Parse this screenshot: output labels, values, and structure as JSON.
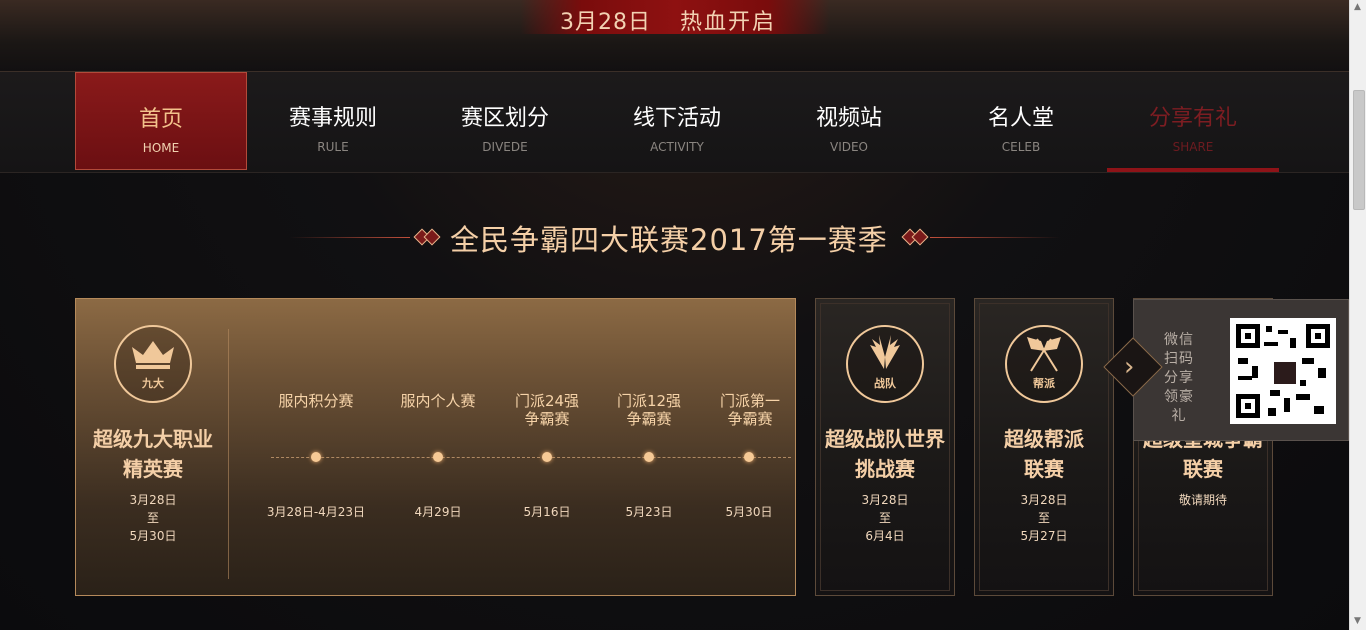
{
  "banner": {
    "date": "3月28日",
    "headline": "热血开启"
  },
  "nav": {
    "items": [
      {
        "zh": "首页",
        "en": "HOME"
      },
      {
        "zh": "赛事规则",
        "en": "RULE"
      },
      {
        "zh": "赛区划分",
        "en": "DIVEDE"
      },
      {
        "zh": "线下活动",
        "en": "ACTIVITY"
      },
      {
        "zh": "视频站",
        "en": "VIDEO"
      },
      {
        "zh": "名人堂",
        "en": "CELEB"
      },
      {
        "zh": "分享有礼",
        "en": "SHARE"
      }
    ]
  },
  "section_title": "全民争霸四大联赛2017第一赛季",
  "main_card": {
    "emblem": "九大",
    "title_line1": "超级九大职业",
    "title_line2": "精英赛",
    "date_start": "3月28日",
    "date_sep": "至",
    "date_end": "5月30日",
    "stages": [
      {
        "line1": "服内积分赛",
        "line2": "",
        "date": "3月28日-4月23日"
      },
      {
        "line1": "服内个人赛",
        "line2": "",
        "date": "4月29日"
      },
      {
        "line1": "门派24强",
        "line2": "争霸赛",
        "date": "5月16日"
      },
      {
        "line1": "门派12强",
        "line2": "争霸赛",
        "date": "5月23日"
      },
      {
        "line1": "门派第一",
        "line2": "争霸赛",
        "date": "5月30日"
      }
    ]
  },
  "side_cards": [
    {
      "emblem": "战队",
      "title_line1": "超级战队世界",
      "title_line2": "挑战赛",
      "date_start": "3月28日",
      "date_sep": "至",
      "date_end": "6月4日"
    },
    {
      "emblem": "帮派",
      "title_line1": "超级帮派",
      "title_line2": "联赛",
      "date_start": "3月28日",
      "date_sep": "至",
      "date_end": "5月27日"
    },
    {
      "title_line1": "超级皇城争霸",
      "title_line2": "联赛",
      "status": "敬请期待"
    }
  ],
  "share_panel": {
    "text": "微信扫码分享领豪礼"
  },
  "colors": {
    "accent_red": "#8e1318",
    "gold": "#f4cfa7",
    "nav_text": "#ffffff"
  }
}
